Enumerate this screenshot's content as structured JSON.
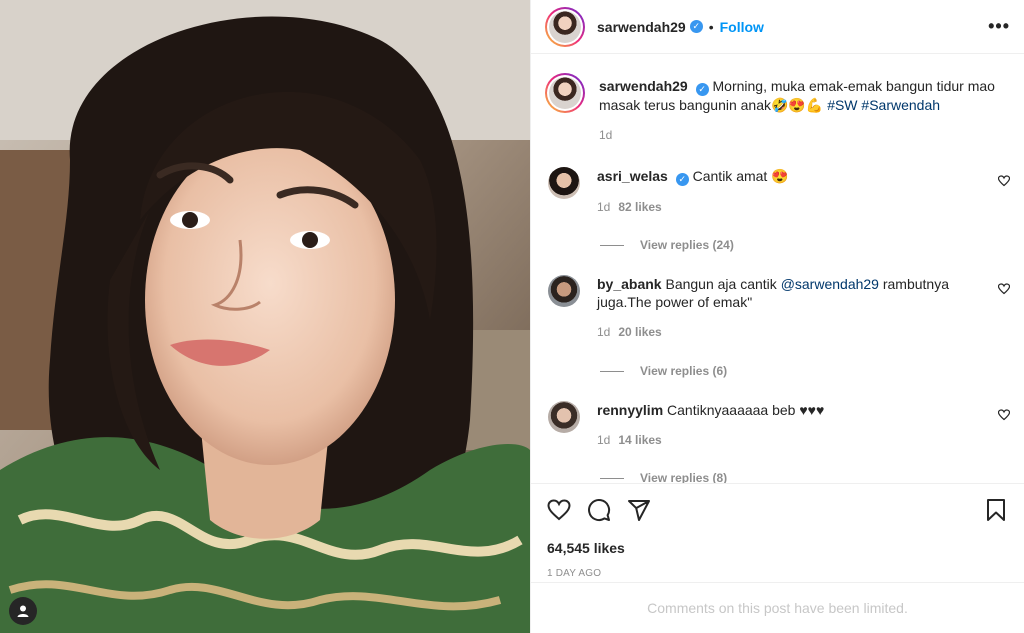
{
  "post": {
    "username": "sarwendah29",
    "follow_label": "Follow",
    "dot": "•",
    "more": "•••"
  },
  "caption": {
    "username": "sarwendah29",
    "text": "Morning, muka emak-emak bangun tidur mao masak terus bangunin anak🤣😍💪",
    "hashtags": "#SW #Sarwendah",
    "time": "1d"
  },
  "comments": [
    {
      "username": "asri_welas",
      "verified": true,
      "text": "Cantik amat 😍",
      "time": "1d",
      "likes": "82 likes",
      "replies": "View replies (24)"
    },
    {
      "username": "by_abank",
      "verified": false,
      "text_before": "Bangun aja cantik ",
      "mention": "@sarwendah29",
      "text_after": " rambutnya juga.The power of emak\"",
      "time": "1d",
      "likes": "20 likes",
      "replies": "View replies (6)"
    },
    {
      "username": "rennyylim",
      "verified": false,
      "text": "Cantiknyaaaaaa beb ♥♥♥",
      "time": "1d",
      "likes": "14 likes",
      "replies": "View replies (8)"
    }
  ],
  "footer": {
    "likes": "64,545 likes",
    "date": "1 DAY AGO",
    "limited": "Comments on this post have been limited."
  },
  "icons": [
    "tag-user-icon",
    "heart-icon",
    "comment-icon",
    "share-icon",
    "bookmark-icon",
    "verified-icon"
  ]
}
